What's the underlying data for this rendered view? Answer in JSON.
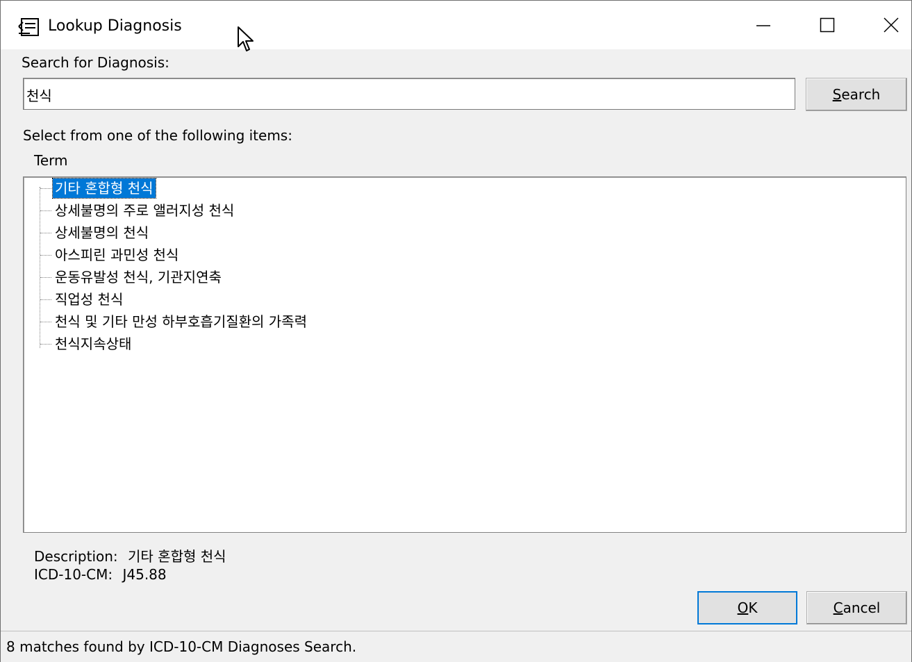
{
  "window": {
    "title": "Lookup Diagnosis",
    "icon": "lookup-book-icon",
    "controls": {
      "minimize": "minimize-icon",
      "maximize": "maximize-icon",
      "close": "close-icon"
    }
  },
  "search": {
    "label": "Search for Diagnosis:",
    "value": "천식",
    "button_prefix": "",
    "button_mnemonic": "S",
    "button_rest": "earch"
  },
  "list": {
    "prompt": "Select from one of the following items:",
    "column_header": "Term",
    "items": [
      "기타 혼합형 천식",
      "상세불명의 주로 앨러지성 천식",
      "상세불명의 천식",
      "아스피린 과민성 천식",
      "운동유발성 천식, 기관지연축",
      "직업성 천식",
      "천식 및 기타 만성 하부호흡기질환의 가족력",
      "천식지속상태"
    ],
    "selected_index": 0
  },
  "details": {
    "description_label": "Description:",
    "description_value": "기타 혼합형 천식",
    "code_label": "ICD-10-CM:",
    "code_value": "J45.88"
  },
  "buttons": {
    "ok_mnemonic": "O",
    "ok_rest": "K",
    "cancel_mnemonic": "C",
    "cancel_rest": "ancel"
  },
  "status": {
    "text": "8 matches found by ICD-10-CM Diagnoses Search."
  },
  "colors": {
    "selection": "#0078d7",
    "window_bg": "#f0f0f0",
    "focus_border": "#0078d7"
  }
}
